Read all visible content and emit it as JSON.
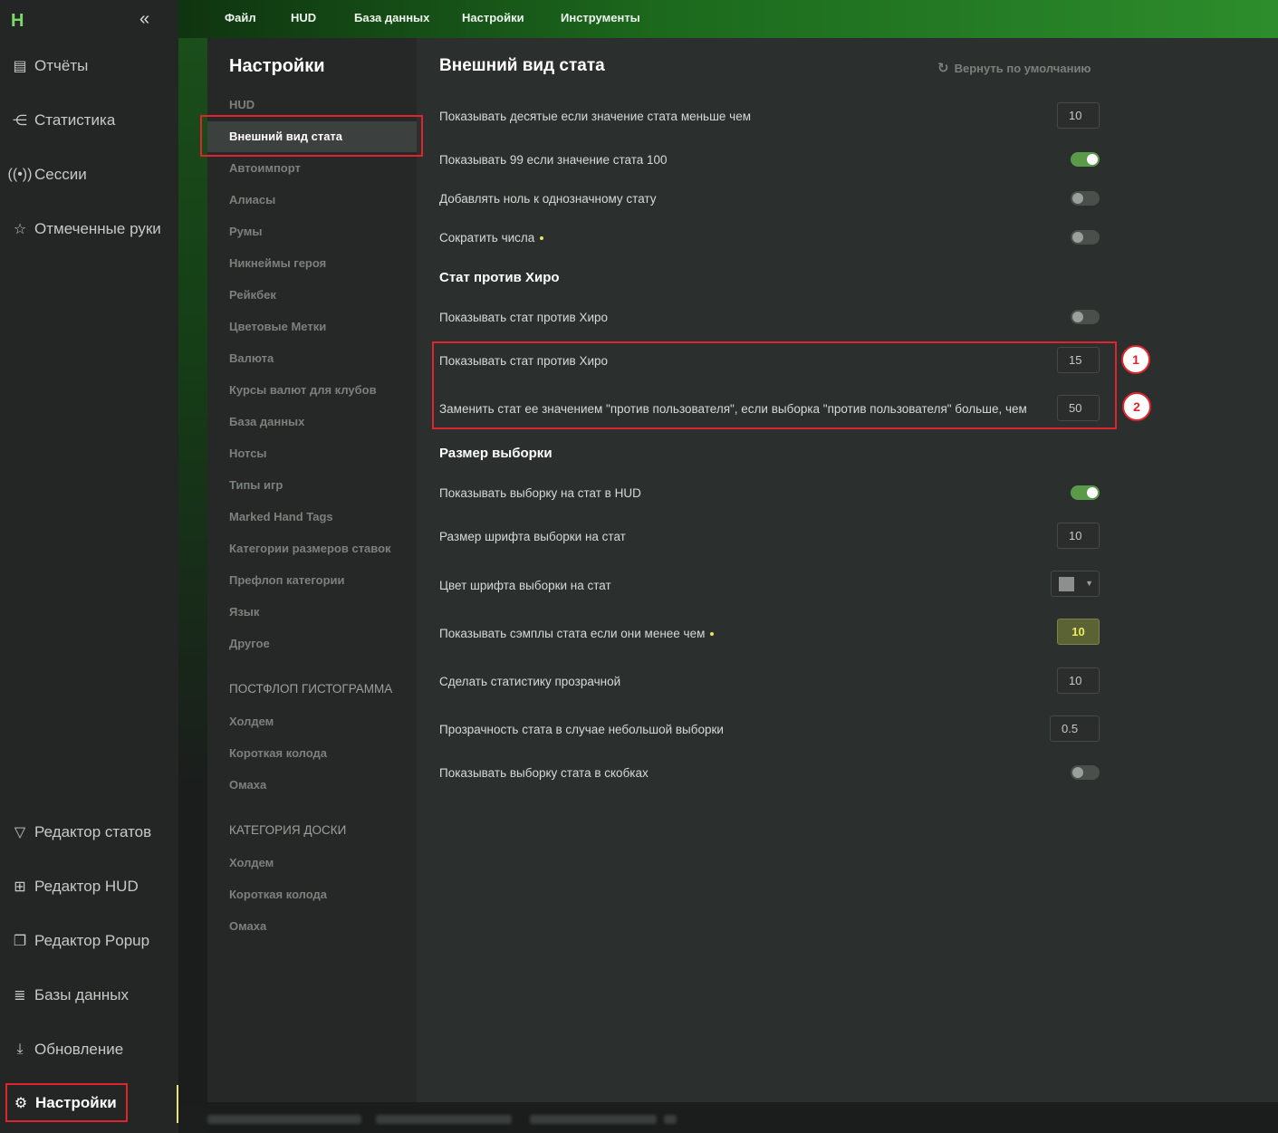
{
  "app": {
    "collapse_icon": "double-chevron-left-icon"
  },
  "sidebar": {
    "items": [
      {
        "label": "Отчёты",
        "icon": "report-icon"
      },
      {
        "label": "Статистика",
        "icon": "share-nodes-icon"
      },
      {
        "label": "Сессии",
        "icon": "broadcast-icon"
      },
      {
        "label": "Отмеченные руки",
        "icon": "starred-list-icon"
      }
    ],
    "bottom_items": [
      {
        "label": "Редактор статов",
        "icon": "filter-icon"
      },
      {
        "label": "Редактор HUD",
        "icon": "layout-icon"
      },
      {
        "label": "Редактор Popup",
        "icon": "popup-icon"
      },
      {
        "label": "Базы данных",
        "icon": "database-icon"
      },
      {
        "label": "Обновление",
        "icon": "download-icon"
      },
      {
        "label": "Настройки",
        "icon": "gear-icon",
        "active": true
      }
    ]
  },
  "menu": {
    "file": "Файл",
    "hud": "HUD",
    "database": "База данных",
    "settings": "Настройки",
    "tools": "Инструменты"
  },
  "settings_nav": {
    "title": "Настройки",
    "group_hud": "HUD",
    "active": "Внешний вид стата",
    "items": [
      "Автоимпорт",
      "Алиасы",
      "Румы",
      "Никнеймы героя",
      "Рейкбек",
      "Цветовые Метки",
      "Валюта",
      "Курсы валют для клубов",
      "База данных",
      "Нотсы",
      "Типы игр",
      "Marked Hand Tags",
      "Категории размеров ставок",
      "Префлоп категории",
      "Язык",
      "Другое"
    ],
    "group_postflop": "ПОСТФЛОП ГИСТОГРАММА",
    "postflop_items": [
      "Холдем",
      "Короткая колода",
      "Омаха"
    ],
    "group_board": "КАТЕГОРИЯ ДОСКИ",
    "board_items": [
      "Холдем",
      "Короткая колода",
      "Омаха"
    ]
  },
  "content": {
    "title": "Внешний вид стата",
    "reset_label": "Вернуть по умолчанию",
    "rows": {
      "tenths": {
        "label": "Показывать десятые если значение стата меньше чем",
        "value": "10"
      },
      "show99": {
        "label": "Показывать 99 если значение стата 100",
        "on": true
      },
      "leading_zero": {
        "label": "Добавлять ноль к однозначному стату",
        "on": false
      },
      "shorten": {
        "label": "Сократить числа",
        "on": false
      }
    },
    "section_hero": "Стат против Хиро",
    "hero_rows": {
      "show_vs_hero": {
        "label": "Показывать стат против Хиро",
        "on": false
      },
      "show_vs_hero_min": {
        "label": "Показывать стат против Хиро",
        "value": "15"
      },
      "replace_vs_user": {
        "label": "Заменить стат ее значением \"против пользователя\", если выборка \"против пользователя\" больше, чем",
        "value": "50"
      }
    },
    "section_sample": "Размер выборки",
    "sample_rows": {
      "show_sample": {
        "label": "Показывать выборку на стат в HUD",
        "on": true
      },
      "font_size": {
        "label": "Размер шрифта выборки на стат",
        "value": "10"
      },
      "font_color": {
        "label": "Цвет шрифта выборки на стат",
        "color": "#8e8e8e"
      },
      "show_samples_under": {
        "label": "Показывать сэмплы стата если они менее чем",
        "value": "10"
      },
      "transparent": {
        "label": "Сделать статистику прозрачной",
        "value": "10"
      },
      "opacity": {
        "label": "Прозрачность стата в случае небольшой выборки",
        "value": "0.5"
      },
      "brackets": {
        "label": "Показывать выборку стата в скобках",
        "on": false
      }
    }
  },
  "annotations": {
    "badge1": "1",
    "badge2": "2"
  },
  "colors": {
    "accent_green": "#2d8d2c",
    "highlight_red": "#e0242b",
    "indicator_yellow": "#e8e36a"
  }
}
